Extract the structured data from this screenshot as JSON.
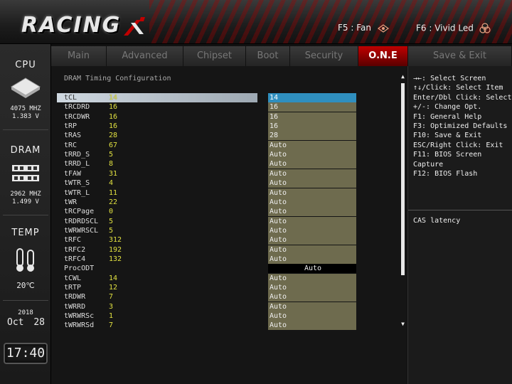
{
  "header": {
    "logo_text": "RACING",
    "hotkey_fan": "F5 : Fan",
    "hotkey_led": "F6 : Vivid Led"
  },
  "sidebar": {
    "cpu": {
      "label": "CPU",
      "freq": "4075 MHZ",
      "volt": "1.383 V"
    },
    "dram": {
      "label": "DRAM",
      "freq": "2962 MHZ",
      "volt": "1.499 V"
    },
    "temp": {
      "label": "TEMP",
      "value": "20℃"
    },
    "date": {
      "year": "2018",
      "month": "Oct",
      "day": "28"
    },
    "clock": "17:40"
  },
  "tabs": [
    {
      "label": "Main"
    },
    {
      "label": "Advanced"
    },
    {
      "label": "Chipset"
    },
    {
      "label": "Boot"
    },
    {
      "label": "Security"
    },
    {
      "label": "O.N.E"
    },
    {
      "label": "Save & Exit"
    }
  ],
  "main": {
    "section_title": "DRAM Timing Configuration",
    "rows": [
      {
        "name": "tCL",
        "current": "14",
        "setting": "14"
      },
      {
        "name": "tRCDRD",
        "current": "16",
        "setting": "16"
      },
      {
        "name": "tRCDWR",
        "current": "16",
        "setting": "16"
      },
      {
        "name": "tRP",
        "current": "16",
        "setting": "16"
      },
      {
        "name": "tRAS",
        "current": "28",
        "setting": "28"
      },
      {
        "name": "tRC",
        "current": "67",
        "setting": "Auto"
      },
      {
        "name": "tRRD_S",
        "current": "5",
        "setting": "Auto"
      },
      {
        "name": "tRRD_L",
        "current": "8",
        "setting": "Auto"
      },
      {
        "name": "tFAW",
        "current": "31",
        "setting": "Auto"
      },
      {
        "name": "tWTR_S",
        "current": "4",
        "setting": "Auto"
      },
      {
        "name": "tWTR_L",
        "current": "11",
        "setting": "Auto"
      },
      {
        "name": "tWR",
        "current": "22",
        "setting": "Auto"
      },
      {
        "name": "tRCPage",
        "current": "0",
        "setting": "Auto"
      },
      {
        "name": "tRDRDSCL",
        "current": "5",
        "setting": "Auto"
      },
      {
        "name": "tWRWRSCL",
        "current": "5",
        "setting": "Auto"
      },
      {
        "name": "tRFC",
        "current": "312",
        "setting": "Auto"
      },
      {
        "name": "tRFC2",
        "current": "192",
        "setting": "Auto"
      },
      {
        "name": "tRFC4",
        "current": "132",
        "setting": "Auto"
      },
      {
        "name": "ProcODT",
        "current": "",
        "setting": "Auto"
      },
      {
        "name": "tCWL",
        "current": "14",
        "setting": "Auto"
      },
      {
        "name": "tRTP",
        "current": "12",
        "setting": "Auto"
      },
      {
        "name": "tRDWR",
        "current": "7",
        "setting": "Auto"
      },
      {
        "name": "tWRRD",
        "current": "3",
        "setting": "Auto"
      },
      {
        "name": "tWRWRSc",
        "current": "1",
        "setting": "Auto"
      },
      {
        "name": "tWRWRSd",
        "current": "7",
        "setting": "Auto"
      }
    ]
  },
  "help": {
    "lines": [
      "→←: Select Screen",
      "↑↓/Click: Select Item",
      "Enter/Dbl Click: Select",
      "+/-: Change Opt.",
      "F1: General Help",
      "F3: Optimized Defaults",
      "F10: Save & Exit",
      "ESC/Right Click: Exit",
      "F11: BIOS Screen",
      "Capture",
      "F12: BIOS Flash"
    ],
    "description": "CAS latency"
  },
  "colors": {
    "accent": "#c00000",
    "value_yellow": "#e0e040",
    "option_box": "#6e6b4e",
    "selected_box": "#2f8fbf"
  }
}
